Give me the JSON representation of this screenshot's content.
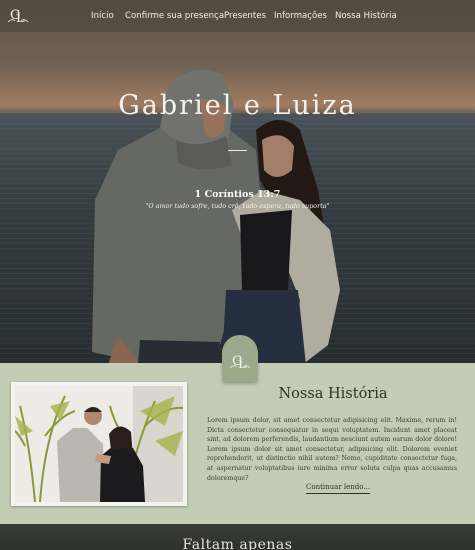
{
  "header": {
    "logo_icon": "gl-monogram-icon",
    "nav": [
      "Início",
      "Confirme sua presença",
      "Presentes",
      "Informações",
      "Nossa História"
    ]
  },
  "hero": {
    "title": "Gabriel  e  Luiza",
    "verse_ref": "1 Coríntios 13:7",
    "verse_text": "\"O amor tudo sofre, tudo crê, tudo espera, tudo suporta\""
  },
  "story": {
    "badge_icon": "gl-monogram-icon",
    "title": "Nossa História",
    "body": "Lorem ipsum dolor, sit amet consectetur adipisicing elit. Maxime, rerum in! Dicta consectetur consequatur in sequi voluptatem. Incidunt amet placeat sint, ad dolorem perferendis, laudantium nesciunt autem earum dolor dolore! Lorem ipsum dolor sit amet consectetur, adipisicing elit. Dolorem eveniet reprehenderit, ut distinctio nihil autem? Nemo, cupiditate consectetur fuga, at aspernatur voluptatibus iure minima error soluta culpa quas accusamus doloremque?",
    "continue_label": "Continuar lendo..."
  },
  "countdown": {
    "title": "Faltam apenas"
  },
  "colors": {
    "sage_background": "#c3cdb6",
    "badge": "#9aaa8a",
    "text_dark": "#2f3129"
  }
}
